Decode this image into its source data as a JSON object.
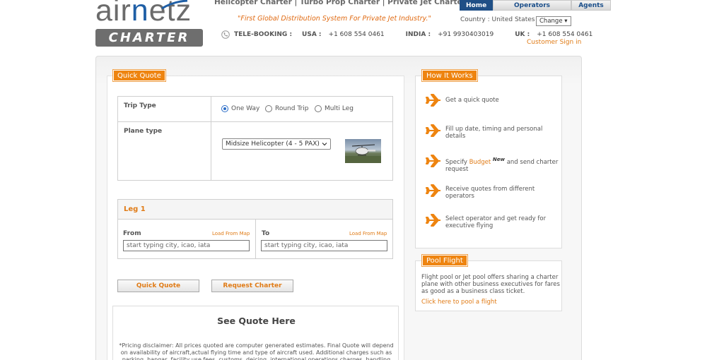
{
  "header": {
    "logo_word_left": "air",
    "logo_word_blue": "n",
    "logo_word_right": "etz",
    "logo_sub": "CHARTER",
    "tagline": "Helicopter Charter | Turbo Prop Charter | Private Jet Charter",
    "slogan": "\"First Global Distribution System For Private Jet Industry.\"",
    "nav": [
      {
        "label": "Home",
        "active": true
      },
      {
        "label": "Operators",
        "active": false
      },
      {
        "label": "Agents",
        "active": false
      }
    ],
    "country_label": "Country : United States",
    "change_label": "Change ▾",
    "telebooking": {
      "label": "TELE-BOOKING :",
      "entries": [
        {
          "region": "USA :",
          "number": "+1 608 554 0461"
        },
        {
          "region": "INDIA :",
          "number": "+91 9930403019"
        },
        {
          "region": "UK :",
          "number": "+1 608 554 0461"
        }
      ]
    },
    "signin": "Customer Sign in"
  },
  "quick_quote": {
    "tab": "Quick Quote",
    "trip_type_label": "Trip Type",
    "trip_options": [
      {
        "label": "One Way",
        "selected": true
      },
      {
        "label": "Round Trip",
        "selected": false
      },
      {
        "label": "Multi Leg",
        "selected": false
      }
    ],
    "plane_type_label": "Plane type",
    "plane_type_value": "Midsize Helicopter (4 - 5 PAX)",
    "leg_title": "Leg 1",
    "from_label": "From",
    "to_label": "To",
    "load_map": "Load From Map",
    "from_placeholder": "start typing city, icao, iata",
    "to_placeholder": "start typing city, icao, iata",
    "btn_quick_quote": "Quick Quote",
    "btn_request_charter": "Request Charter",
    "see_quote_title": "See Quote Here",
    "disclaimer": "*Pricing disclaimer: All prices quoted are computer generated estimates. Final Quote will depend on availability of aircraft,actual flying time and type of aircraft used. Additional charges such as parking, hangar, facility use fees, customs, deicing, international operations charges, handling fees,"
  },
  "how_it_works": {
    "tab": "How It Works",
    "steps": [
      "Get a quick quote",
      "Fill up date, timing and personal details",
      "Receive quotes from different operators",
      "Select operator and get ready for executive flying"
    ],
    "budget_pre": "Specify ",
    "budget_word": "Budget",
    "budget_new": "New",
    "budget_post": " and send charter request"
  },
  "pool_flight": {
    "tab": "Pool Flight",
    "text": "Flight pool or Jet pool offers sharing a charter plane with other business executives for fares as good as a business class ticket.",
    "link": "Click here to pool a flight"
  },
  "colors": {
    "accent_orange": "#ee8410",
    "brand_blue": "#1f5fa6",
    "nav_active": "#1f4f86"
  }
}
